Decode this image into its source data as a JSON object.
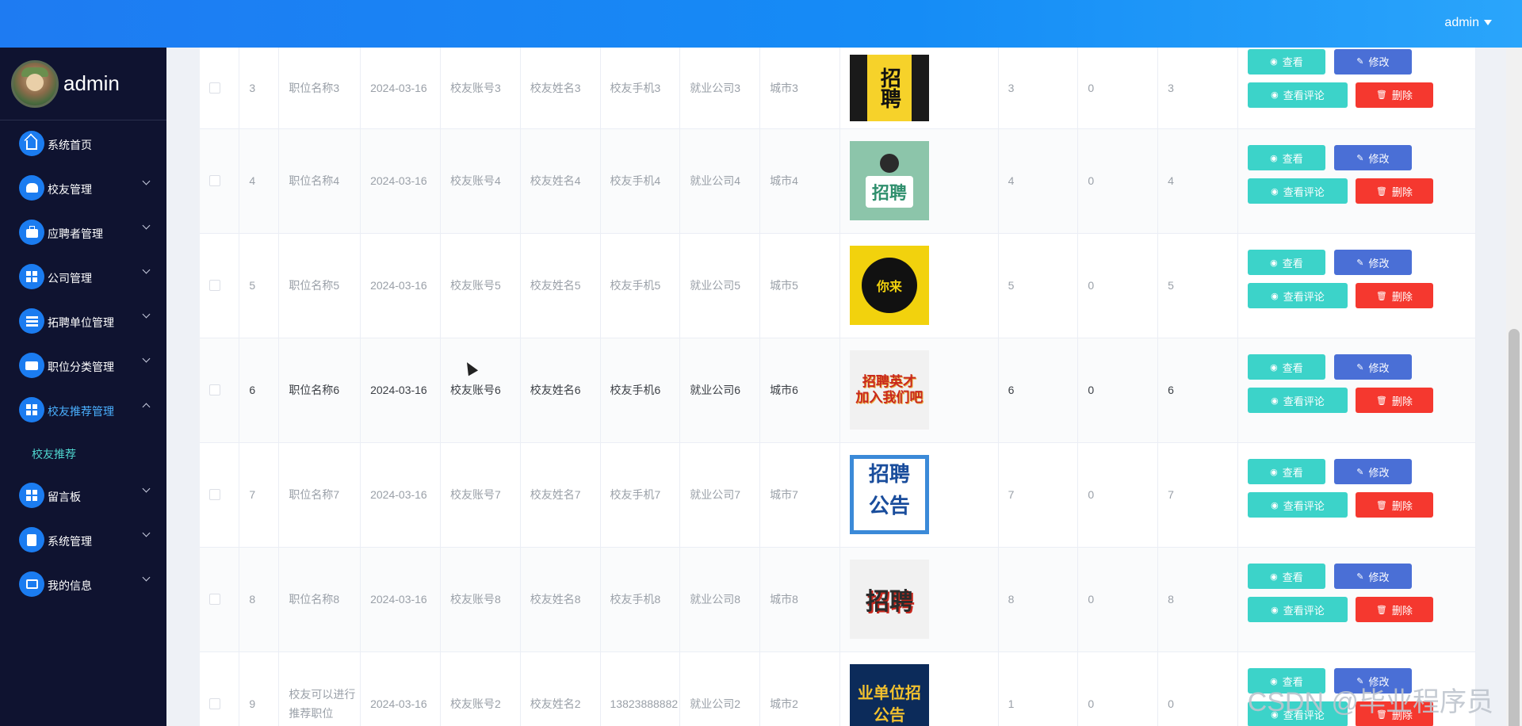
{
  "header": {
    "user_label": "admin"
  },
  "sidebar": {
    "username": "admin",
    "items": [
      {
        "label": "系统首页",
        "icon": "home-icon",
        "has_children": false
      },
      {
        "label": "校友管理",
        "icon": "user-icon",
        "has_children": true
      },
      {
        "label": "应聘者管理",
        "icon": "briefcase-icon",
        "has_children": true
      },
      {
        "label": "公司管理",
        "icon": "grid-icon",
        "has_children": true
      },
      {
        "label": "拓聘单位管理",
        "icon": "list-icon",
        "has_children": true
      },
      {
        "label": "职位分类管理",
        "icon": "ticket-icon",
        "has_children": true
      },
      {
        "label": "校友推荐管理",
        "icon": "grid-icon",
        "has_children": true,
        "expanded": true
      },
      {
        "label": "留言板",
        "icon": "grid-icon",
        "has_children": true
      },
      {
        "label": "系统管理",
        "icon": "clipboard-icon",
        "has_children": true
      },
      {
        "label": "我的信息",
        "icon": "card-icon",
        "has_children": true
      }
    ],
    "sub_items": [
      {
        "label": "校友推荐"
      }
    ]
  },
  "table": {
    "rows": [
      {
        "index": "3",
        "position": "职位名称3",
        "date": "2024-03-16",
        "account": "校友账号3",
        "name": "校友姓名3",
        "phone": "校友手机3",
        "company": "就业公司3",
        "city": "城市3",
        "n1": "3",
        "n2": "0",
        "n3": "3"
      },
      {
        "index": "4",
        "position": "职位名称4",
        "date": "2024-03-16",
        "account": "校友账号4",
        "name": "校友姓名4",
        "phone": "校友手机4",
        "company": "就业公司4",
        "city": "城市4",
        "n1": "4",
        "n2": "0",
        "n3": "4"
      },
      {
        "index": "5",
        "position": "职位名称5",
        "date": "2024-03-16",
        "account": "校友账号5",
        "name": "校友姓名5",
        "phone": "校友手机5",
        "company": "就业公司5",
        "city": "城市5",
        "n1": "5",
        "n2": "0",
        "n3": "5"
      },
      {
        "index": "6",
        "position": "职位名称6",
        "date": "2024-03-16",
        "account": "校友账号6",
        "name": "校友姓名6",
        "phone": "校友手机6",
        "company": "就业公司6",
        "city": "城市6",
        "n1": "6",
        "n2": "0",
        "n3": "6"
      },
      {
        "index": "7",
        "position": "职位名称7",
        "date": "2024-03-16",
        "account": "校友账号7",
        "name": "校友姓名7",
        "phone": "校友手机7",
        "company": "就业公司7",
        "city": "城市7",
        "n1": "7",
        "n2": "0",
        "n3": "7"
      },
      {
        "index": "8",
        "position": "职位名称8",
        "date": "2024-03-16",
        "account": "校友账号8",
        "name": "校友姓名8",
        "phone": "校友手机8",
        "company": "就业公司8",
        "city": "城市8",
        "n1": "8",
        "n2": "0",
        "n3": "8"
      },
      {
        "index": "9",
        "position": "校友可以进行推荐职位",
        "date": "2024-03-16",
        "account": "校友账号2",
        "name": "校友姓名2",
        "phone": "13823888882",
        "company": "就业公司2",
        "city": "城市2",
        "n1": "1",
        "n2": "0",
        "n3": "0"
      }
    ],
    "images": [
      {
        "lines": [
          "招聘"
        ]
      },
      {
        "lines": [
          "招聘"
        ]
      },
      {
        "lines": [
          "你来"
        ]
      },
      {
        "lines": [
          "招聘英才",
          "加入我们吧"
        ]
      },
      {
        "lines": [
          "招聘",
          "公告"
        ]
      },
      {
        "lines": [
          "招聘"
        ]
      },
      {
        "lines": [
          "业单位招",
          "公告"
        ]
      }
    ],
    "actions": {
      "view": "查看",
      "edit": "修改",
      "comments": "查看评论",
      "delete": "删除"
    }
  },
  "watermark": "CSDN @毕业程序员",
  "colors": {
    "topbar": "#1e7bf2",
    "sidebar": "#0f1330",
    "accent_teal": "#3cd3c9",
    "edit_blue": "#4a6fd6",
    "danger": "#f5382f"
  }
}
